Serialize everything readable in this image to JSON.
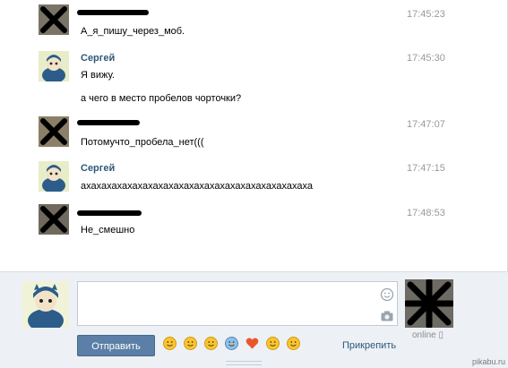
{
  "messages": [
    {
      "author": "",
      "redacted": true,
      "time": "17:45:23",
      "lines": [
        "А_я_пишу_через_моб."
      ]
    },
    {
      "author": "Сергей",
      "redacted": false,
      "time": "17:45:30",
      "lines": [
        "Я вижу.",
        "а чего в место пробелов чорточки?"
      ]
    },
    {
      "author": "",
      "redacted": true,
      "time": "17:47:07",
      "lines": [
        "Потомучто_пробела_нет((("
      ]
    },
    {
      "author": "Сергей",
      "redacted": false,
      "time": "17:47:15",
      "lines": [
        "ахахахахахахахахахахахахахахахахахахахахахаха"
      ]
    },
    {
      "author": "",
      "redacted": true,
      "time": "17:48:53",
      "lines": [
        "Не_смешно"
      ]
    }
  ],
  "composer": {
    "input_value": "",
    "send_label": "Отправить",
    "attach_label": "Прикрепить",
    "online_label": "online",
    "emojis": [
      "wink-emoji",
      "grin-emoji",
      "kiss-emoji",
      "scared-emoji",
      "heart-emoji",
      "neutral-emoji",
      "laugh-emoji"
    ]
  },
  "watermark": "pikabu.ru",
  "colors": {
    "accent": "#2b587a",
    "button": "#5b7fa6",
    "composer_bg": "#edf1f5",
    "time": "#999999"
  }
}
